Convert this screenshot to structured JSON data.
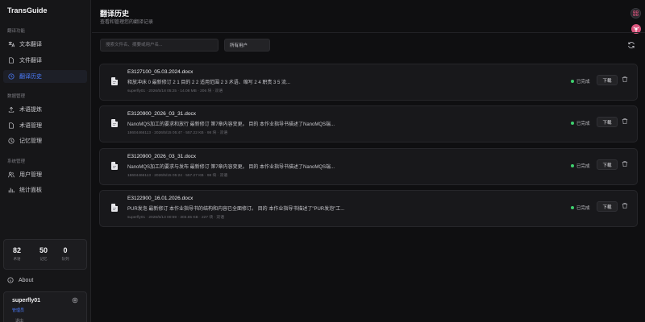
{
  "app": {
    "name": "TransGuide"
  },
  "sidebar": {
    "sections": [
      {
        "label": "翻译功能"
      },
      {
        "label": "数据管理"
      },
      {
        "label": "系统管理"
      }
    ],
    "items": [
      {
        "label": "文本翻译",
        "icon": "translate-icon"
      },
      {
        "label": "文件翻译",
        "icon": "file-icon"
      },
      {
        "label": "翻译历史",
        "icon": "history-icon",
        "active": true
      },
      {
        "label": "术语提炼",
        "icon": "upload-icon"
      },
      {
        "label": "术语管理",
        "icon": "file-icon"
      },
      {
        "label": "记忆管理",
        "icon": "history-icon"
      },
      {
        "label": "用户管理",
        "icon": "users-icon"
      },
      {
        "label": "统计面板",
        "icon": "chart-icon"
      }
    ],
    "stats": [
      {
        "value": "82",
        "label": "术语"
      },
      {
        "value": "50",
        "label": "记忆"
      },
      {
        "value": "0",
        "label": "队列"
      }
    ],
    "about_label": "About",
    "user": {
      "name": "superfly01",
      "role": "管理员",
      "logout_label": "退出"
    }
  },
  "header": {
    "title": "翻译历史",
    "subtitle": "查看和管理您的翻译记录"
  },
  "filters": {
    "search_placeholder": "搜索文件名、摘要或用户名...",
    "user_filter": "所有用户"
  },
  "records": [
    {
      "file_name": "E3127100_05.03.2024.docx",
      "description": "释放冲床 0 最新修订 2 1 目的 2 2 适用范围 2 3 术语、缩写 2 4 职责 3 5 流...",
      "meta": "superfly01 · 2026/5/18 05:25 · 14.08 MB · 206 块 · 双语",
      "status": "已完成",
      "download_label": "下载"
    },
    {
      "file_name": "E3120900_2026_03_31.docx",
      "description": "NanoMQS加工的要求和放行 最新修订 第7章内容变更。 目的 本作业指导书描述了NanoMQS端...",
      "meta": "18604466113 · 2026/5/15 05:47 · 557.22 KB · 98 块 · 双语",
      "status": "已完成",
      "download_label": "下载"
    },
    {
      "file_name": "E3120900_2026_03_31.docx",
      "description": "NanoMQS加工的要求与发布 最新修订 第7章内容变更。 目的 本作业指导书描述了NanoMQS端...",
      "meta": "18604466113 · 2026/5/15 05:24 · 557.27 KB · 98 块 · 双语",
      "status": "已完成",
      "download_label": "下载"
    },
    {
      "file_name": "E3122900_16.01.2026.docx",
      "description": "PUR发泡 最新修订 本作业指导书的结构和内容已全面修订。 目的 本作业指导书描述了\"PUR发泡\"工...",
      "meta": "superfly01 · 2026/5/13 00:59 · 303.65 KB · 227 块 · 双语",
      "status": "已完成",
      "download_label": "下载"
    }
  ],
  "colors": {
    "accent": "#4c7dff",
    "status_done": "#3ecf6e",
    "avatar_pink": "#d9557d"
  }
}
